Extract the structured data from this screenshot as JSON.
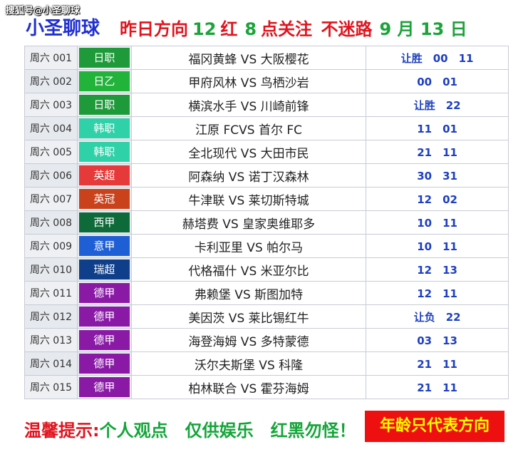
{
  "watermark": "搜狐号@小圣聊球",
  "header": {
    "brand": "小圣聊球",
    "yesterday_label": "昨日方向",
    "win_count": "12",
    "red_label": "红",
    "red_count": "8",
    "follow": "点关注",
    "no_lost": "不迷路",
    "date": "9 月 13 日"
  },
  "matches": [
    {
      "date": "周六 001",
      "league": "日职",
      "league_color": "#1f9a3a",
      "teams": "福冈黄蜂 VS 大阪樱花",
      "pick": "让胜　00　11"
    },
    {
      "date": "周六 002",
      "league": "日乙",
      "league_color": "#22b33a",
      "teams": "甲府风林 VS 鸟栖沙岩",
      "pick": "00　01"
    },
    {
      "date": "周六 003",
      "league": "日职",
      "league_color": "#1f9a3a",
      "teams": "横滨水手 VS 川崎前锋",
      "pick": "让胜　22"
    },
    {
      "date": "周六 004",
      "league": "韩职",
      "league_color": "#2fd1a8",
      "teams": "江原 FCVS 首尔 FC",
      "pick": "11　01"
    },
    {
      "date": "周六 005",
      "league": "韩职",
      "league_color": "#2fd1a8",
      "teams": "全北现代 VS 大田市民",
      "pick": "21　11"
    },
    {
      "date": "周六 006",
      "league": "英超",
      "league_color": "#e63a3a",
      "teams": "阿森纳 VS 诺丁汉森林",
      "pick": "30　31"
    },
    {
      "date": "周六 007",
      "league": "英冠",
      "league_color": "#c9421b",
      "teams": "牛津联 VS 莱切斯特城",
      "pick": "12　02"
    },
    {
      "date": "周六 008",
      "league": "西甲",
      "league_color": "#0e6b39",
      "teams": "赫塔费 VS 皇家奥维耶多",
      "pick": "10　11"
    },
    {
      "date": "周六 009",
      "league": "意甲",
      "league_color": "#1e5fd6",
      "teams": "卡利亚里 VS 帕尔马",
      "pick": "10　11"
    },
    {
      "date": "周六 010",
      "league": "瑞超",
      "league_color": "#0f3e8a",
      "teams": "代格福什 VS 米亚尔比",
      "pick": "12　13"
    },
    {
      "date": "周六 011",
      "league": "德甲",
      "league_color": "#8a1aa6",
      "teams": "弗赖堡 VS 斯图加特",
      "pick": "12　11"
    },
    {
      "date": "周六 012",
      "league": "德甲",
      "league_color": "#8a1aa6",
      "teams": "美因茨 VS 莱比锡红牛",
      "pick": "让负　22"
    },
    {
      "date": "周六 013",
      "league": "德甲",
      "league_color": "#8a1aa6",
      "teams": "海登海姆 VS 多特蒙德",
      "pick": "03　13"
    },
    {
      "date": "周六 014",
      "league": "德甲",
      "league_color": "#8a1aa6",
      "teams": "沃尔夫斯堡 VS 科隆",
      "pick": "21　11"
    },
    {
      "date": "周六 015",
      "league": "德甲",
      "league_color": "#8a1aa6",
      "teams": "柏林联合 VS 霍芬海姆",
      "pick": "21　11"
    }
  ],
  "footer": {
    "tip_label": "温馨提示:",
    "tip_text": "个人观点　仅供娱乐　红黑勿怪！",
    "age_note": "年龄只代表方向"
  }
}
